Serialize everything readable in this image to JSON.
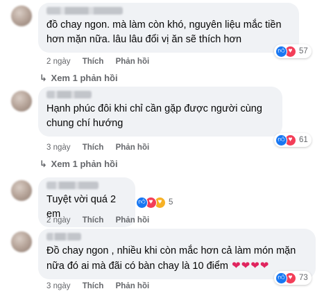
{
  "comments": [
    {
      "text": "đồ chay ngon. mà làm còn khó, nguyên liệu mắc tiền hơn mặn nữa. lâu lâu đổi vị ăn sẽ thích hơn",
      "reaction_count": "57",
      "time": "2 ngày",
      "like_label": "Thích",
      "reply_label": "Phản hồi",
      "view_replies": "Xem 1 phản hồi"
    },
    {
      "text": "Hạnh phúc đôi khi chỉ cần gặp được người cùng chung chí hướng",
      "reaction_count": "61",
      "time": "3 ngày",
      "like_label": "Thích",
      "reply_label": "Phản hồi",
      "view_replies": "Xem 1 phản hồi"
    },
    {
      "text": "Tuyệt vời quá 2 em",
      "reaction_count": "5",
      "time": "2 ngày",
      "like_label": "Thích",
      "reply_label": "Phản hồi"
    },
    {
      "text": "Đồ chay ngon , nhiều khi còn mắc hơn cả làm món mặn nữa đó ai mà đãi có bàn chay là 10 điểm",
      "reaction_count": "73",
      "time": "3 ngày",
      "like_label": "Thích",
      "reply_label": "Phản hồi"
    }
  ],
  "icons": {
    "like": "thumbs-up",
    "love": "heart",
    "care": "care-hug",
    "reply_arrow": "reply-arrow",
    "emoji_heart": "red-heart"
  },
  "colors": {
    "like_blue": "#1877f2",
    "love_red": "#f33e58",
    "care_yellow": "#f7b125",
    "bubble_bg": "#f0f2f5",
    "meta_gray": "#65676b"
  }
}
